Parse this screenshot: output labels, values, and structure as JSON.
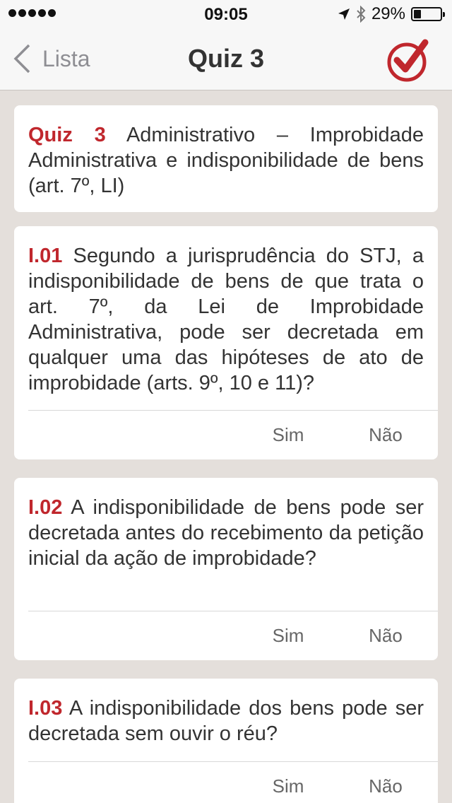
{
  "status": {
    "time": "09:05",
    "battery": "29%",
    "battery_level": 0.29
  },
  "nav": {
    "back_label": "Lista",
    "title": "Quiz 3"
  },
  "header_card": {
    "label": "Quiz 3",
    "text": " Administrativo – Improbidade Administrativa e indisponibilidade de bens (art. 7º, LI)"
  },
  "questions": [
    {
      "id": "I.01",
      "text": " Segundo a jurisprudência do STJ, a indisponibilidade de bens de que trata o art. 7º, da Lei de Improbidade Administrativa, pode ser decretada em qualquer uma das hipóteses de ato de improbidade (arts. 9º, 10 e 11)?",
      "yes": "Sim",
      "no": "Não"
    },
    {
      "id": "I.02",
      "text": " A indisponibilidade de bens pode ser decretada antes do recebimento da petição inicial da ação de improbidade?",
      "yes": "Sim",
      "no": "Não"
    },
    {
      "id": "I.03",
      "text": " A indisponibilidade dos bens pode ser decretada sem ouvir o réu?",
      "yes": "Sim",
      "no": "Não"
    }
  ],
  "colors": {
    "accent": "#c0272d",
    "background": "#e4dfdb"
  }
}
